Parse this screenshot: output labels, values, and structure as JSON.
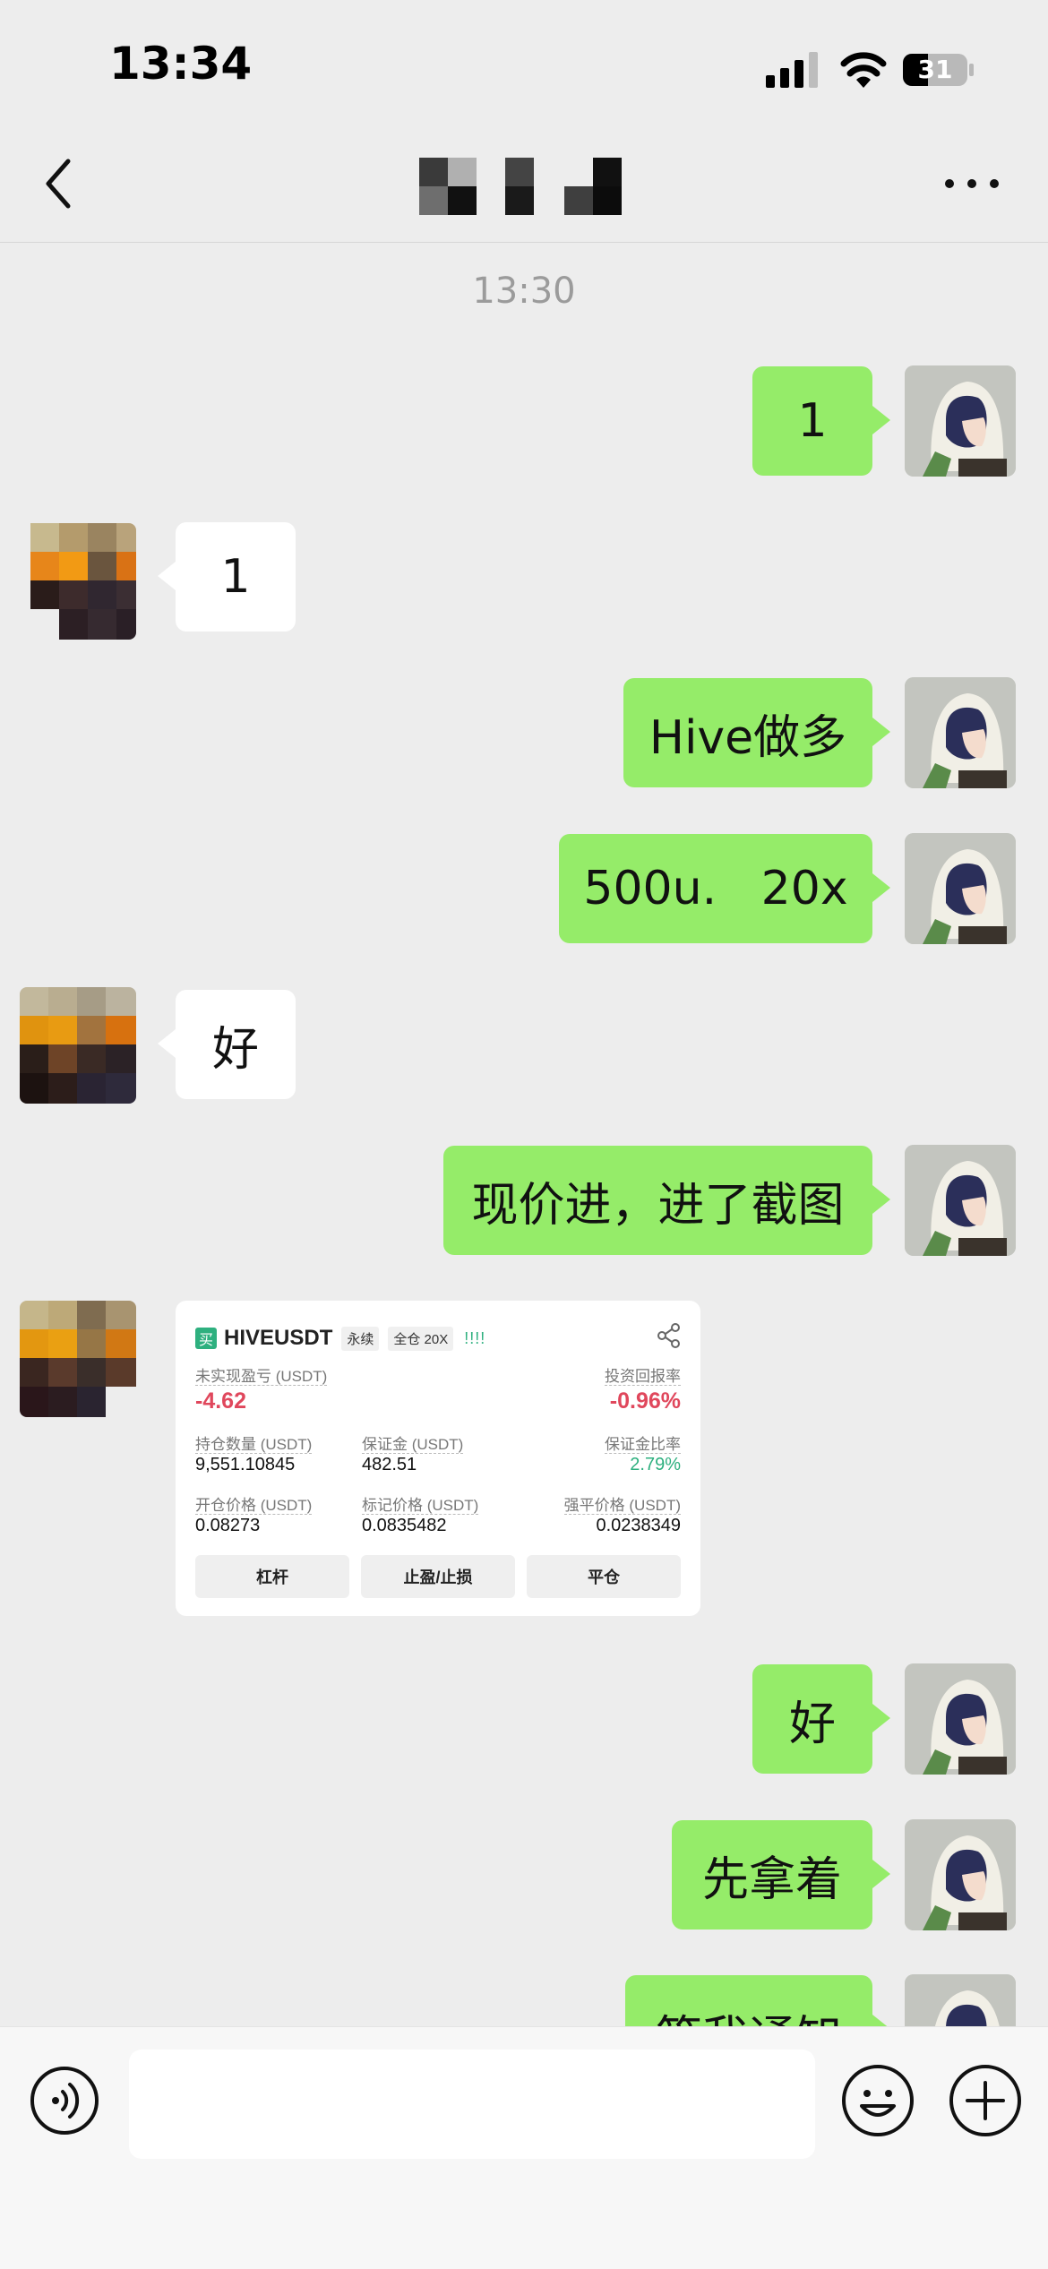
{
  "status_bar": {
    "time": "13:34",
    "battery": "31"
  },
  "nav": {
    "title_obscured": true
  },
  "timestamp": "13:30",
  "messages": [
    {
      "side": "out",
      "text": "1"
    },
    {
      "side": "in",
      "text": "1"
    },
    {
      "side": "out",
      "text": "Hive做多"
    },
    {
      "side": "out",
      "text": "500u.   20x"
    },
    {
      "side": "in",
      "text": "好"
    },
    {
      "side": "out",
      "text": "现价进，进了截图"
    },
    {
      "side": "in",
      "type": "image-card"
    },
    {
      "side": "out",
      "text": "好"
    },
    {
      "side": "out",
      "text": "先拿着"
    },
    {
      "side": "out",
      "text": "等我通知"
    }
  ],
  "card": {
    "buy_tag": "买",
    "symbol": "HIVEUSDT",
    "chip_perp": "永续",
    "chip_margin": "全仓 20X",
    "bars": "!!!!",
    "unrealized_label": "未实现盈亏 (USDT)",
    "unrealized_value": "-4.62",
    "roi_label": "投资回报率",
    "roi_value": "-0.96%",
    "size_label": "持仓数量 (USDT)",
    "size_value": "9,551.10845",
    "margin_label": "保证金 (USDT)",
    "margin_value": "482.51",
    "margin_ratio_label": "保证金比率",
    "margin_ratio_value": "2.79%",
    "entry_label": "开仓价格 (USDT)",
    "entry_value": "0.08273",
    "mark_label": "标记价格 (USDT)",
    "mark_value": "0.0835482",
    "liq_label": "强平价格 (USDT)",
    "liq_value": "0.0238349",
    "btn_leverage": "杠杆",
    "btn_tpsl": "止盈/止损",
    "btn_close": "平仓"
  },
  "colors": {
    "bubble_out": "#95ec69",
    "bubble_in": "#ffffff",
    "background": "#ededed",
    "loss_red": "#e0475c",
    "gain_green": "#2eb07f"
  }
}
